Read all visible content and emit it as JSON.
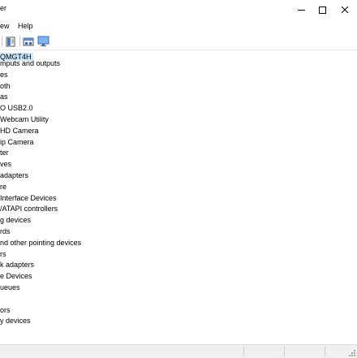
{
  "window": {
    "title": "er",
    "controls": {
      "minimize": "minimize-icon",
      "maximize": "maximize-icon",
      "close": "close-icon"
    }
  },
  "menu": {
    "view": "ew",
    "help": "Help"
  },
  "toolbar": {
    "buttons": [
      {
        "name": "properties-icon"
      },
      {
        "name": "update-driver-icon"
      },
      {
        "name": "monitor-icon"
      }
    ]
  },
  "tree": {
    "root": "QMGT4H",
    "items": [
      "mputs and outputs",
      "es",
      "oth",
      "as",
      "O USB2.0",
      "Webcam Utility",
      "HD Camera",
      "ip Camera",
      "ter",
      "ves",
      "adapters",
      "re",
      "Interface Devices",
      "/ATAPI controllers",
      "g devices",
      "rds",
      "nd other pointing devices",
      "rs",
      "k adapters",
      "e Devices",
      "ueues",
      "",
      "ors",
      "y devices"
    ]
  },
  "colors": {
    "selection": "#cce8ff",
    "statusbar": "#f0f0f0"
  }
}
